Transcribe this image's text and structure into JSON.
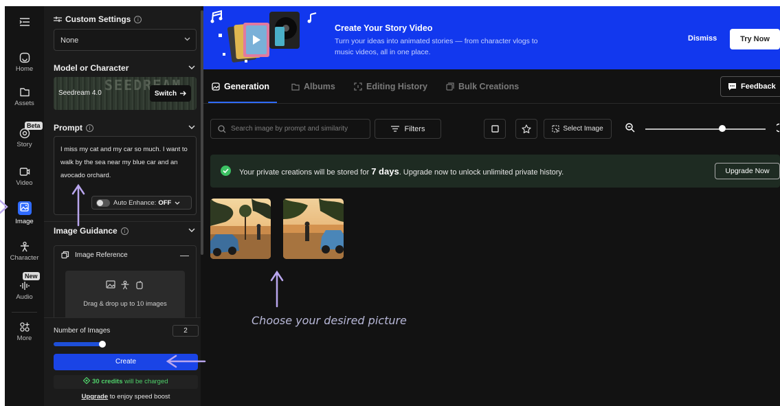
{
  "sidebar": {
    "items": [
      {
        "label": "Home",
        "icon": "home-icon"
      },
      {
        "label": "Assets",
        "icon": "folder-icon"
      },
      {
        "label": "Story",
        "icon": "story-icon",
        "badge": "Beta"
      },
      {
        "label": "Video",
        "icon": "video-icon"
      },
      {
        "label": "Image",
        "icon": "image-icon",
        "active": true
      },
      {
        "label": "Character",
        "icon": "character-icon"
      },
      {
        "label": "Audio",
        "icon": "audio-icon",
        "badge": "New"
      },
      {
        "label": "More",
        "icon": "more-icon"
      }
    ]
  },
  "panel": {
    "custom_settings": {
      "title": "Custom Settings",
      "selected": "None"
    },
    "model": {
      "title": "Model or Character",
      "name": "Seedream 4.0",
      "watermark": "SEEDREAM",
      "switch_label": "Switch"
    },
    "prompt": {
      "title": "Prompt",
      "text": "I miss my cat and my car so much. I want to walk by the sea near my blue car and an avocado orchard.",
      "auto_enhance_label": "Auto Enhance:",
      "auto_enhance_value": "OFF"
    },
    "image_guidance": {
      "title": "Image Guidance",
      "reference_label": "Image Reference",
      "drop_text": "Drag & drop up to 10 images"
    },
    "number_of_images": {
      "label": "Number of Images",
      "value": "2"
    },
    "create_label": "Create",
    "credits": {
      "amount": "30 credits",
      "suffix": "will be charged"
    },
    "upgrade": {
      "link": "Upgrade",
      "suffix": "to enjoy speed boost"
    }
  },
  "banner": {
    "title": "Create Your Story Video",
    "subtitle": "Turn your ideas into animated stories — from character vlogs to music videos, all in one place.",
    "dismiss_label": "Dismiss",
    "try_label": "Try Now",
    "color": "#1238ee"
  },
  "tabs": [
    {
      "label": "Generation",
      "active": true
    },
    {
      "label": "Albums"
    },
    {
      "label": "Editing History"
    },
    {
      "label": "Bulk Creations"
    }
  ],
  "feedback_label": "Feedback",
  "toolbar": {
    "search_placeholder": "Search image by prompt and similarity",
    "filters_label": "Filters",
    "select_image_label": "Select Image"
  },
  "notice": {
    "prefix": "Your private creations will be stored for",
    "days": "7 days",
    "suffix": ". Upgrade now to unlock unlimited private history.",
    "button": "Upgrade Now"
  },
  "annotation": {
    "caption": "Choose your desired picture",
    "color": "#b9a6ee"
  },
  "accent": "#2f6bff"
}
